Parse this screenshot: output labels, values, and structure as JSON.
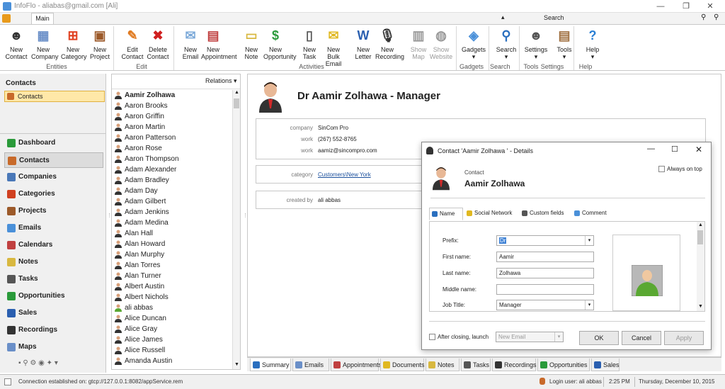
{
  "window": {
    "title": "InfoFlo - aliabas@gmail.com [Ali]",
    "search_label": "Search"
  },
  "ribbon": {
    "tab": "Main",
    "buttons": [
      {
        "id": "new-contact",
        "l1": "New",
        "l2": "Contact"
      },
      {
        "id": "new-company",
        "l1": "New",
        "l2": "Company"
      },
      {
        "id": "new-category",
        "l1": "New",
        "l2": "Category"
      },
      {
        "id": "new-project",
        "l1": "New",
        "l2": "Project"
      },
      {
        "id": "edit-contact",
        "l1": "Edit",
        "l2": "Contact"
      },
      {
        "id": "delete-contact",
        "l1": "Delete",
        "l2": "Contact"
      },
      {
        "id": "new-email",
        "l1": "New",
        "l2": "Email"
      },
      {
        "id": "new-appointment",
        "l1": "New",
        "l2": "Appointment"
      },
      {
        "id": "new-note",
        "l1": "New",
        "l2": "Note"
      },
      {
        "id": "new-opportunity",
        "l1": "New",
        "l2": "Opportunity"
      },
      {
        "id": "new-task",
        "l1": "New",
        "l2": "Task"
      },
      {
        "id": "new-bulk-email",
        "l1": "New",
        "l2": "Bulk Email"
      },
      {
        "id": "new-letter",
        "l1": "New",
        "l2": "Letter"
      },
      {
        "id": "new-recording",
        "l1": "New",
        "l2": "Recording"
      },
      {
        "id": "show-map",
        "l1": "Show",
        "l2": "Map"
      },
      {
        "id": "show-website",
        "l1": "Show",
        "l2": "Website"
      },
      {
        "id": "gadgets",
        "l1": "Gadgets",
        "l2": "▾"
      },
      {
        "id": "search",
        "l1": "Search",
        "l2": "▾"
      },
      {
        "id": "settings",
        "l1": "Settings",
        "l2": "▾"
      },
      {
        "id": "tools",
        "l1": "Tools",
        "l2": "▾"
      },
      {
        "id": "help",
        "l1": "Help",
        "l2": "▾"
      }
    ],
    "groups": [
      "Entities",
      "Edit",
      "Activities",
      "Gadgets",
      "Search",
      "Tools",
      "Settings",
      "Help"
    ]
  },
  "sidebar": {
    "header": "Contacts",
    "selected": "Contacts",
    "nav": [
      "Dashboard",
      "Contacts",
      "Companies",
      "Categories",
      "Projects",
      "Emails",
      "Calendars",
      "Notes",
      "Tasks",
      "Opportunities",
      "Sales",
      "Recordings",
      "Maps"
    ]
  },
  "list": {
    "relations": "Relations ▾",
    "items": [
      "Aamir Zolhawa",
      "Aaron Brooks",
      "Aaron Griffin",
      "Aaron Martin",
      "Aaron Patterson",
      "Aaron Rose",
      "Aaron Thompson",
      "Adam Alexander",
      "Adam Bradley",
      "Adam Day",
      "Adam Gilbert",
      "Adam Jenkins",
      "Adam Medina",
      "Alan Hall",
      "Alan Howard",
      "Alan Murphy",
      "Alan Torres",
      "Alan Turner",
      "Albert Austin",
      "Albert Nichols",
      "ali abbas",
      "Alice Duncan",
      "Alice Gray",
      "Alice James",
      "Alice Russell",
      "Amanda Austin"
    ]
  },
  "detail": {
    "heading": "Dr Aamir Zolhawa - Manager",
    "company_label": "company",
    "company": "SinCom Pro",
    "work_phone_label": "work",
    "work_phone": "(267) 552-8765",
    "work_email_label": "work",
    "work_email": "aamiz@sincompro.com",
    "category_label": "category",
    "category": "Customers\\New York",
    "created_label": "created by",
    "created": "ali abbas"
  },
  "dialog": {
    "title": "Contact 'Aamir Zolhawa ' - Details",
    "contact_label": "Contact",
    "contact_name": "Aamir Zolhawa",
    "always_on_top": "Always on top",
    "tabs": [
      "Name",
      "Social Network",
      "Custom fields",
      "Comment"
    ],
    "prefix_label": "Prefix:",
    "prefix": "Dr",
    "first_label": "First name:",
    "first": "Aamir",
    "last_label": "Last name:",
    "last": "Zolhawa",
    "middle_label": "Middle name:",
    "middle": "",
    "job_label": "Job Title:",
    "job": "Manager",
    "after_closing": "After closing, launch",
    "launch_placeholder": "New Email",
    "ok": "OK",
    "cancel": "Cancel",
    "apply": "Apply"
  },
  "bottom_tabs": [
    "Summary",
    "Emails",
    "Appointments",
    "Documents",
    "Notes",
    "Tasks",
    "Recordings",
    "Opportunities",
    "Sales"
  ],
  "status": {
    "connection": "Connection established on: gtcp://127.0.0.1:8082/appService.rem",
    "user": "Login user: ali abbas",
    "time": "2:25 PM",
    "date": "Thursday, December 10, 2015"
  }
}
